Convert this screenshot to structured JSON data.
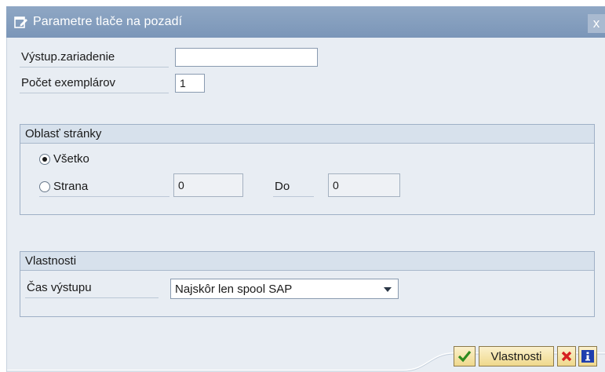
{
  "window": {
    "title": "Parametre tlače na pozadí",
    "close_glyph": "x"
  },
  "form": {
    "output_device": {
      "label": "Výstup.zariadenie",
      "value": ""
    },
    "copies": {
      "label": "Počet exemplárov",
      "value": "1"
    }
  },
  "page_area": {
    "heading": "Oblasť stránky",
    "all": {
      "label": "Všetko",
      "selected": true
    },
    "page": {
      "label": "Strana",
      "selected": false,
      "from_value": "0"
    },
    "to": {
      "label": "Do",
      "value": "0"
    }
  },
  "properties": {
    "heading": "Vlastnosti",
    "output_time": {
      "label": "Čas výstupu",
      "value": "Najskôr len spool SAP"
    }
  },
  "buttons": {
    "properties_label": "Vlastnosti"
  },
  "icons": {
    "title": "window-edit-icon",
    "confirm": "green-check-icon",
    "cancel": "red-x-icon",
    "info": "info-icon"
  },
  "colors": {
    "titlebar": "#7b96b8",
    "panel": "#e8edf3",
    "group_header": "#d7e1ec",
    "button": "#efd98c"
  }
}
